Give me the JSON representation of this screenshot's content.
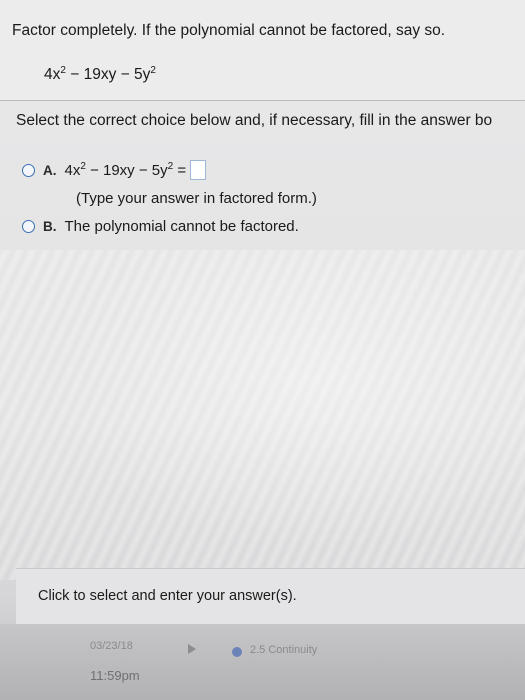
{
  "question": {
    "title": "Factor completely. If the polynomial cannot be factored, say so.",
    "expression": {
      "a": "4x",
      "e1": "2",
      "b": " − 19xy − 5y",
      "e2": "2"
    }
  },
  "instructions": "Select the correct choice below and, if necessary, fill in the answer bo",
  "choices": {
    "a": {
      "letter": "A.",
      "expr_a": "4x",
      "e1": "2",
      "expr_b": " − 19xy − 5y",
      "e2": "2",
      "eq": " =",
      "hint": "(Type your answer in factored form.)"
    },
    "b": {
      "letter": "B.",
      "text": "The polynomial cannot be factored."
    }
  },
  "footer": {
    "prompt": "Click to select and enter your answer(s)."
  },
  "status_bar": {
    "date": "03/23/18",
    "time": "11:59pm",
    "section": "2.5 Continuity"
  },
  "colors": {
    "radio_border": "#3a6fb0",
    "status_dot": "#6b83b8"
  }
}
